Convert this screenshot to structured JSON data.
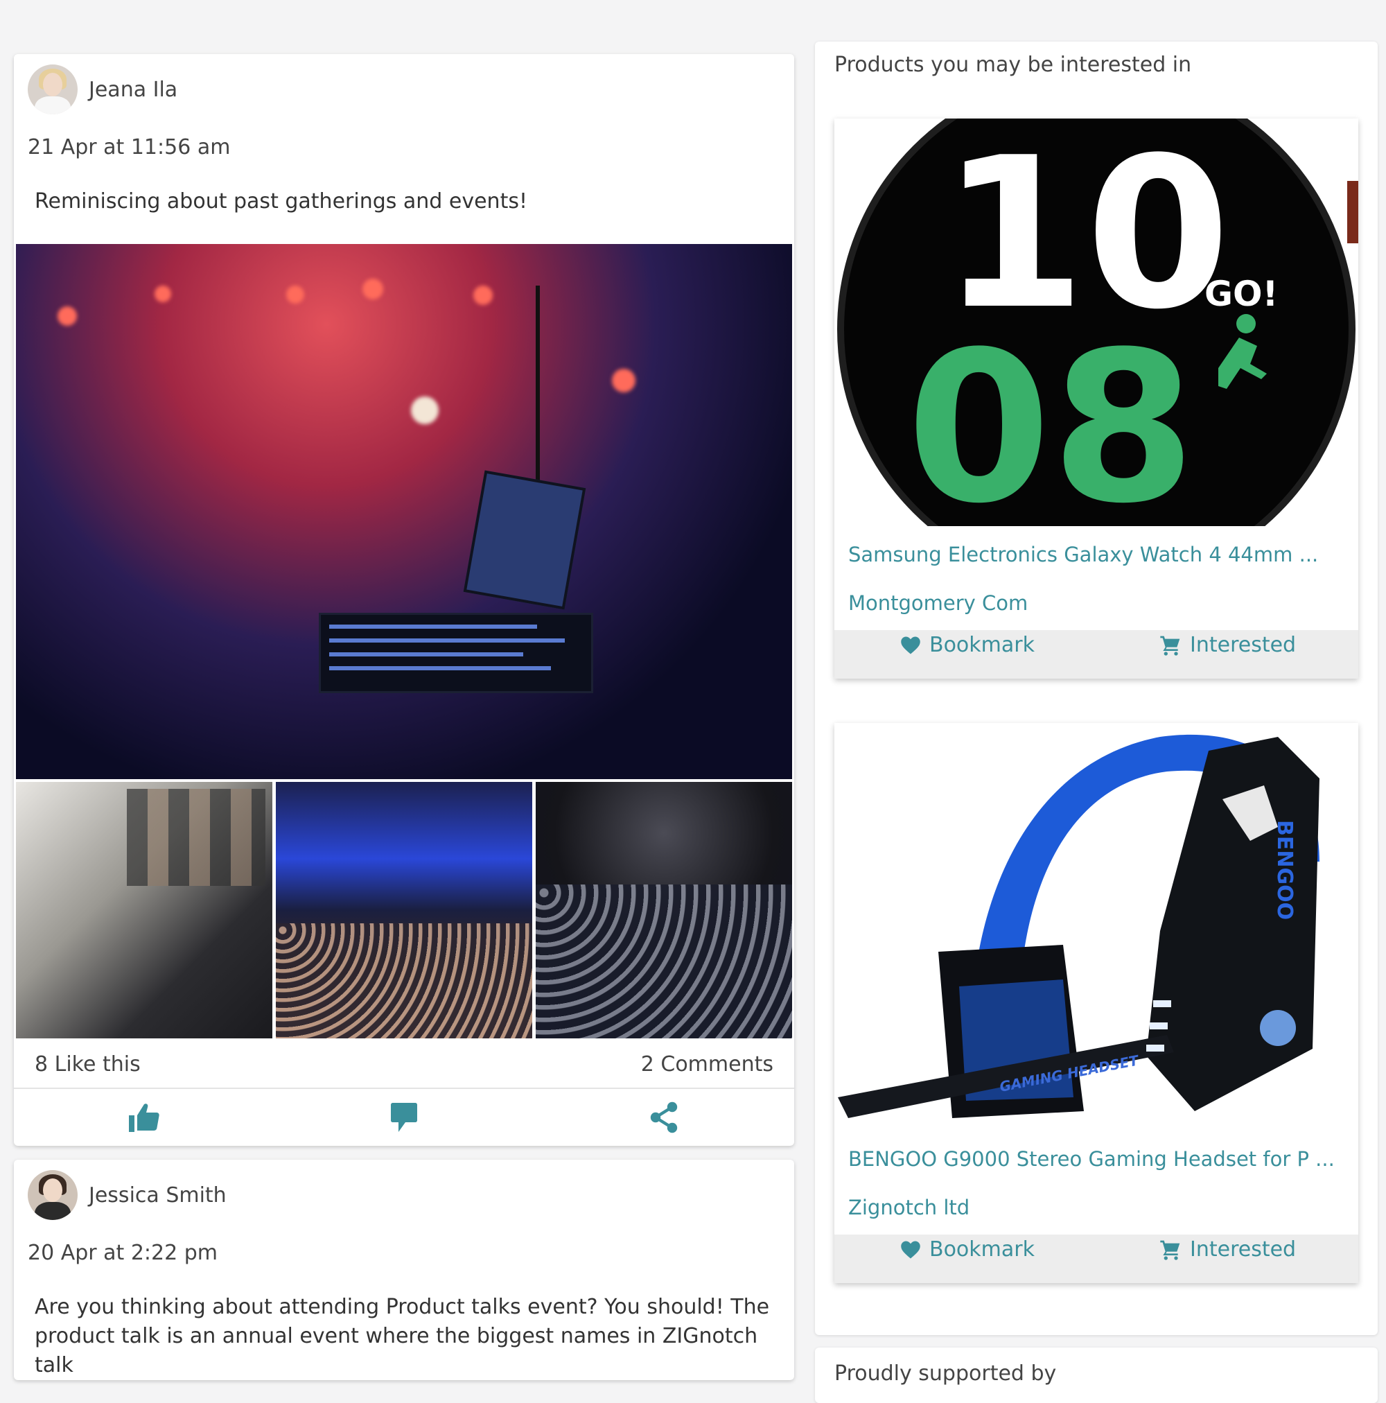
{
  "posts": [
    {
      "author": "Jeana Ila",
      "timestamp": "21 Apr at 11:56 am",
      "text": "Reminiscing about past gatherings and events!",
      "likes": "8 Like this",
      "comments": "2 Comments"
    },
    {
      "author": "Jessica Smith",
      "timestamp": "20 Apr at 2:22 pm",
      "text": "Are you thinking about attending Product talks event? You should! The product talk is an annual event where the biggest names in ZIGnotch talk"
    }
  ],
  "post_actions": {
    "like_icon": "thumbs-up-icon",
    "comment_icon": "comment-icon",
    "share_icon": "share-icon"
  },
  "sidebar": {
    "title": "Products you may be interested in",
    "products": [
      {
        "name": "Samsung Electronics Galaxy Watch 4 44mm ...",
        "seller": "Montgomery Com",
        "bookmark_label": "Bookmark",
        "interested_label": "Interested",
        "image_text": {
          "hour": "10",
          "minute": "08",
          "badge": "GO!"
        }
      },
      {
        "name": "BENGOO G9000 Stereo Gaming Headset for P ...",
        "seller": "Zignotch ltd",
        "bookmark_label": "Bookmark",
        "interested_label": "Interested",
        "image_text": {
          "brand": "BENGOO",
          "label": "GAMING HEADSET"
        }
      }
    ]
  },
  "supported": {
    "title": "Proudly supported by"
  },
  "colors": {
    "accent": "#3a8f9b",
    "text": "#444444",
    "background": "#f4f4f5"
  }
}
